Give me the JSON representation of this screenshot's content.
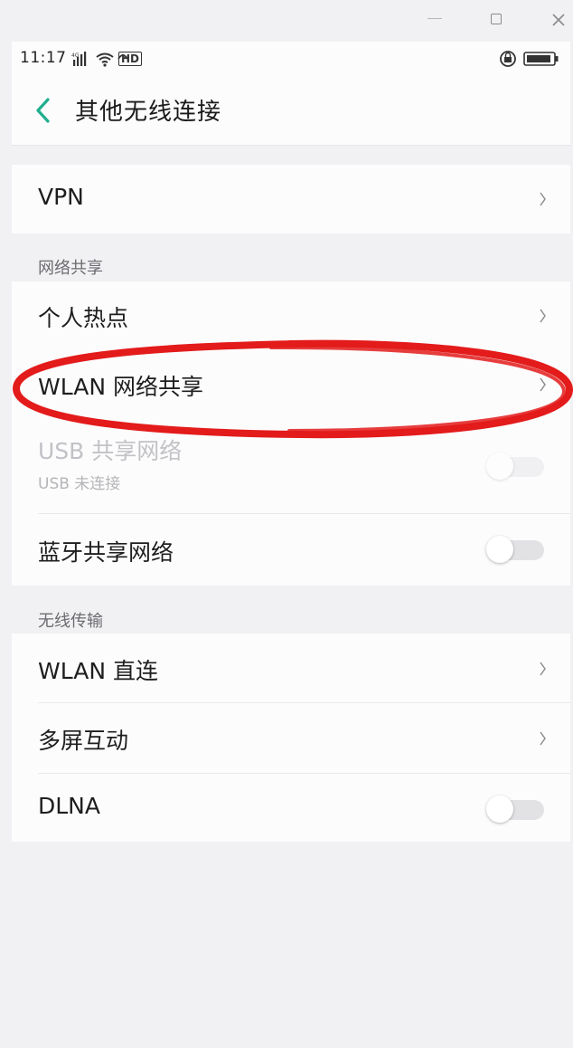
{
  "window": {
    "minimize_icon": "minimize-icon",
    "maximize_icon": "maximize-icon",
    "close_icon": "close-icon"
  },
  "statusbar": {
    "time": "11:17",
    "network_badge": "HD"
  },
  "header": {
    "title": "其他无线连接"
  },
  "groups": {
    "vpn": {
      "label": "VPN"
    },
    "sharing": {
      "header": "网络共享",
      "items": [
        {
          "label": "个人热点",
          "control": "chevron"
        },
        {
          "label": "WLAN 网络共享",
          "control": "chevron"
        },
        {
          "label": "USB 共享网络",
          "sublabel": "USB 未连接",
          "control": "toggle",
          "enabled": false,
          "on": false
        },
        {
          "label": "蓝牙共享网络",
          "control": "toggle",
          "enabled": true,
          "on": false
        }
      ]
    },
    "wireless": {
      "header": "无线传输",
      "items": [
        {
          "label": "WLAN 直连",
          "control": "chevron"
        },
        {
          "label": "多屏互动",
          "control": "chevron"
        },
        {
          "label": "DLNA",
          "control": "toggle",
          "enabled": true,
          "on": false
        }
      ]
    }
  },
  "colors": {
    "accent": "#1fae8e",
    "highlight_annotation": "#e31b1b",
    "page_bg": "#f1f1f3",
    "card_bg": "#fcfcfd"
  }
}
